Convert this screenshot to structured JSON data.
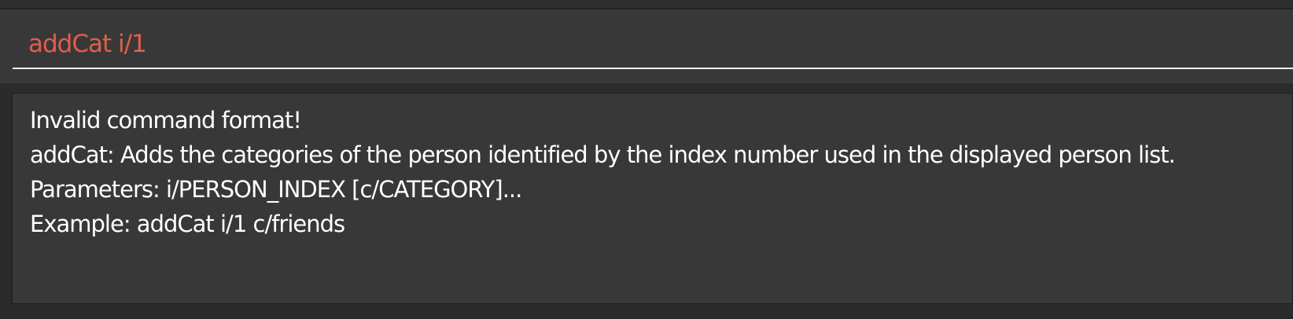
{
  "command_box": {
    "value": "addCat i/1"
  },
  "result_display": {
    "lines": [
      "Invalid command format!",
      "addCat: Adds the categories of the person identified by the index number used in the displayed person list.",
      "Parameters: i/PERSON_INDEX [c/CATEGORY]...",
      "Example: addCat i/1 c/friends"
    ]
  },
  "colors": {
    "background": "#2b2b2b",
    "panel": "#383838",
    "command_text": "#e05e4a",
    "result_text": "#ffffff"
  }
}
